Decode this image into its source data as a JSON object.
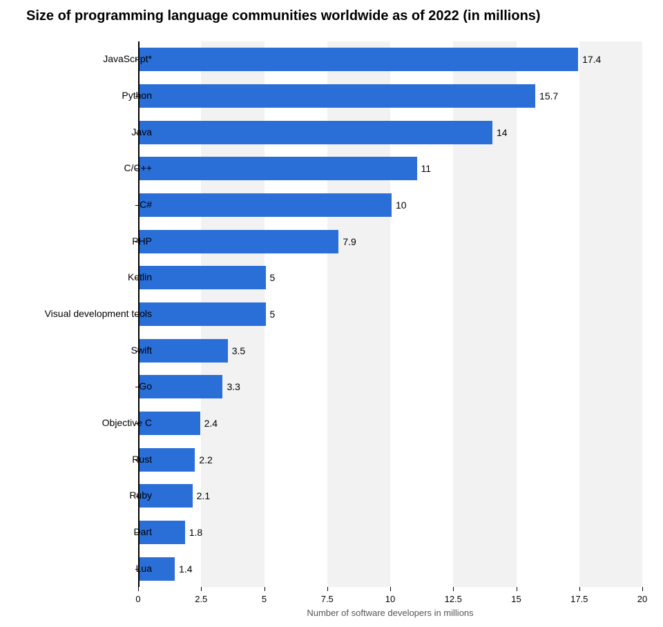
{
  "chart_data": {
    "type": "bar",
    "title": "Size of programming language communities worldwide as of 2022 (in millions)",
    "xlabel": "Number of software developers in millions",
    "ylabel": "",
    "categories": [
      "JavaScript*",
      "Python",
      "Java",
      "C/C++",
      "C#",
      "PHP",
      "Kotlin",
      "Visual development tools",
      "Swift",
      "Go",
      "Objective C",
      "Rust",
      "Ruby",
      "Dart",
      "Lua"
    ],
    "values": [
      17.4,
      15.7,
      14,
      11,
      10,
      7.9,
      5,
      5,
      3.5,
      3.3,
      2.4,
      2.2,
      2.1,
      1.8,
      1.4
    ],
    "xlim": [
      0,
      20
    ],
    "x_ticks": [
      0,
      2.5,
      5,
      7.5,
      10,
      12.5,
      15,
      17.5,
      20
    ],
    "bar_color": "#2a6ed8"
  }
}
